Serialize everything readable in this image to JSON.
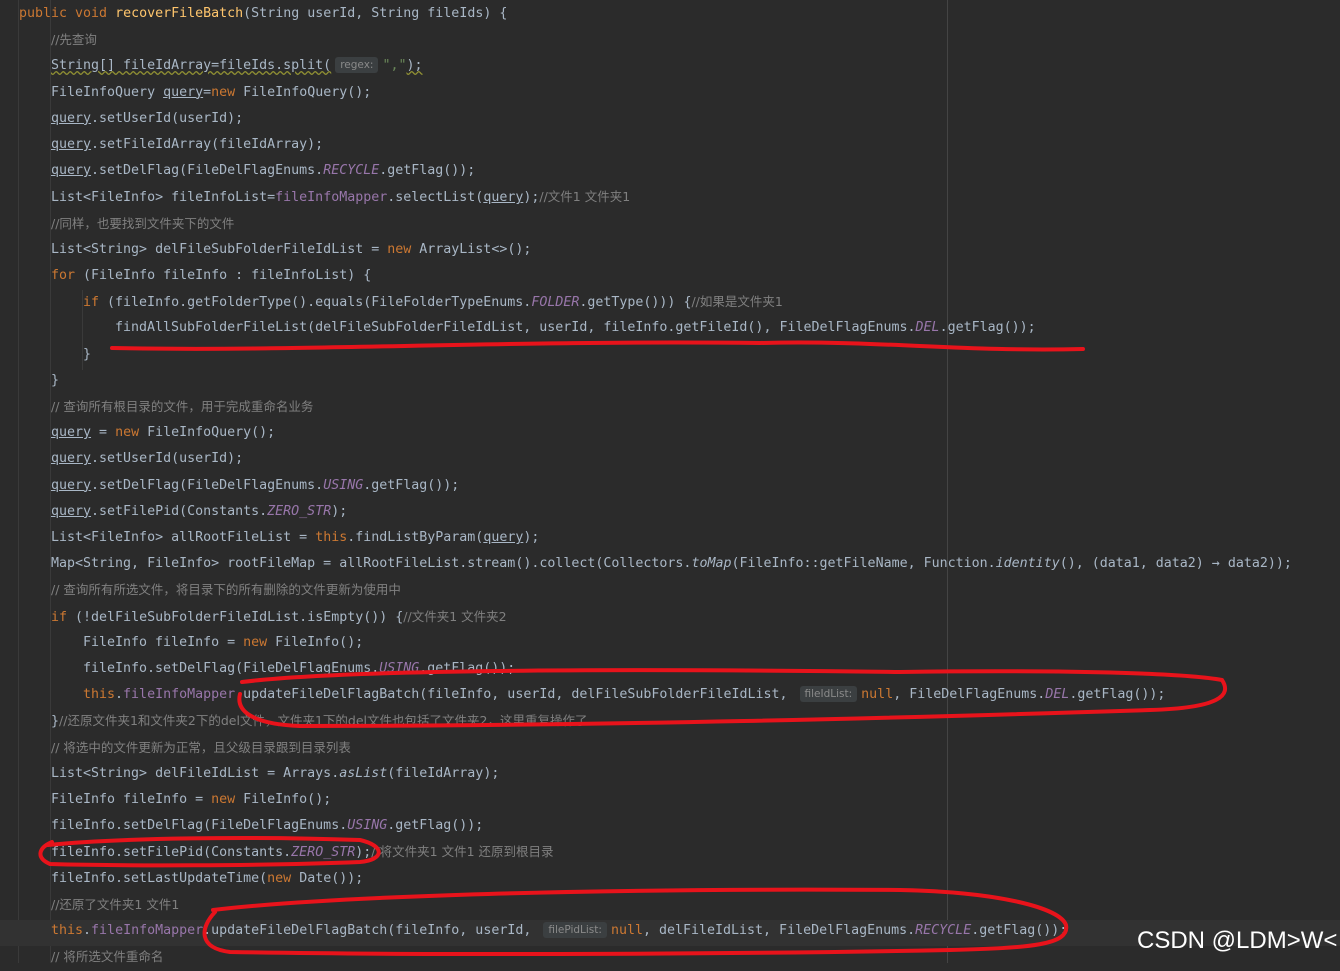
{
  "watermark": "CSDN @LDM>W<",
  "colors": {
    "background": "#2b2b2b",
    "keyword": "#cc7832",
    "method": "#ffc66d",
    "comment": "#808080",
    "field": "#9876aa",
    "string": "#6a8759",
    "annotation": "#e8131b"
  },
  "code": [
    {
      "tokens": [
        {
          "c": "kw",
          "t": "public void "
        },
        {
          "c": "fn",
          "t": "recoverFileBatch"
        },
        {
          "c": "pl",
          "t": "(String userId, String fileIds) {"
        }
      ]
    },
    {
      "tokens": [
        {
          "c": "cmc",
          "t": "//先查询"
        }
      ]
    },
    {
      "tokens": [
        {
          "c": "warn",
          "t": "String[] fileIdArray=fileIds.split("
        },
        {
          "c": "hint",
          "t": "regex:"
        },
        {
          "c": "str",
          "t": "\",\""
        },
        {
          "c": "warn",
          "t": ");"
        }
      ]
    },
    {
      "tokens": [
        {
          "c": "pl",
          "t": "FileInfoQuery "
        },
        {
          "c": "ul",
          "t": "query"
        },
        {
          "c": "pl",
          "t": "="
        },
        {
          "c": "kw",
          "t": "new "
        },
        {
          "c": "pl",
          "t": "FileInfoQuery();"
        }
      ]
    },
    {
      "tokens": [
        {
          "c": "ul",
          "t": "query"
        },
        {
          "c": "pl",
          "t": ".setUserId(userId);"
        }
      ]
    },
    {
      "tokens": [
        {
          "c": "ul",
          "t": "query"
        },
        {
          "c": "pl",
          "t": ".setFileIdArray(fileIdArray);"
        }
      ]
    },
    {
      "tokens": [
        {
          "c": "ul",
          "t": "query"
        },
        {
          "c": "pl",
          "t": ".setDelFlag(FileDelFlagEnums."
        },
        {
          "c": "efld",
          "t": "RECYCLE"
        },
        {
          "c": "pl",
          "t": ".getFlag());"
        }
      ]
    },
    {
      "tokens": [
        {
          "c": "pl",
          "t": "List<FileInfo> fileInfoList="
        },
        {
          "c": "fld",
          "t": "fileInfoMapper"
        },
        {
          "c": "pl",
          "t": ".selectList("
        },
        {
          "c": "ul",
          "t": "query"
        },
        {
          "c": "pl",
          "t": ");"
        },
        {
          "c": "cmc",
          "t": "//文件1 文件夹1"
        }
      ]
    },
    {
      "tokens": [
        {
          "c": "cmc",
          "t": "//同样，也要找到文件夹下的文件"
        }
      ]
    },
    {
      "tokens": [
        {
          "c": "pl",
          "t": "List<String> delFileSubFolderFileIdList = "
        },
        {
          "c": "kw",
          "t": "new "
        },
        {
          "c": "pl",
          "t": "ArrayList<>();"
        }
      ]
    },
    {
      "tokens": [
        {
          "c": "kw",
          "t": "for "
        },
        {
          "c": "pl",
          "t": "(FileInfo fileInfo : fileInfoList) {"
        }
      ]
    },
    {
      "tokens": [
        {
          "c": "kw",
          "t": "if "
        },
        {
          "c": "pl",
          "t": "(fileInfo.getFolderType().equals(FileFolderTypeEnums."
        },
        {
          "c": "efld",
          "t": "FOLDER"
        },
        {
          "c": "pl",
          "t": ".getType())) {"
        },
        {
          "c": "cmc",
          "t": "//如果是文件夹1"
        }
      ]
    },
    {
      "tokens": [
        {
          "c": "pl",
          "t": "findAllSubFolderFileList(delFileSubFolderFileIdList, userId, fileInfo.getFileId(), FileDelFlagEnums."
        },
        {
          "c": "efld",
          "t": "DEL"
        },
        {
          "c": "pl",
          "t": ".getFlag());"
        }
      ]
    },
    {
      "tokens": [
        {
          "c": "pl",
          "t": "}"
        }
      ]
    },
    {
      "tokens": [
        {
          "c": "pl",
          "t": "}"
        }
      ]
    },
    {
      "tokens": [
        {
          "c": "cmc",
          "t": "// 查询所有根目录的文件，用于完成重命名业务"
        }
      ]
    },
    {
      "tokens": [
        {
          "c": "ul",
          "t": "query"
        },
        {
          "c": "pl",
          "t": " = "
        },
        {
          "c": "kw",
          "t": "new "
        },
        {
          "c": "pl",
          "t": "FileInfoQuery();"
        }
      ]
    },
    {
      "tokens": [
        {
          "c": "ul",
          "t": "query"
        },
        {
          "c": "pl",
          "t": ".setUserId(userId);"
        }
      ]
    },
    {
      "tokens": [
        {
          "c": "ul",
          "t": "query"
        },
        {
          "c": "pl",
          "t": ".setDelFlag(FileDelFlagEnums."
        },
        {
          "c": "efld",
          "t": "USING"
        },
        {
          "c": "pl",
          "t": ".getFlag());"
        }
      ]
    },
    {
      "tokens": [
        {
          "c": "ul",
          "t": "query"
        },
        {
          "c": "pl",
          "t": ".setFilePid(Constants."
        },
        {
          "c": "efld",
          "t": "ZERO_STR"
        },
        {
          "c": "pl",
          "t": ");"
        }
      ]
    },
    {
      "tokens": [
        {
          "c": "pl",
          "t": "List<FileInfo> allRootFileList = "
        },
        {
          "c": "kw",
          "t": "this"
        },
        {
          "c": "pl",
          "t": ".findListByParam("
        },
        {
          "c": "ul",
          "t": "query"
        },
        {
          "c": "pl",
          "t": ");"
        }
      ]
    },
    {
      "tokens": [
        {
          "c": "pl",
          "t": "Map<String, FileInfo> rootFileMap = allRootFileList.stream().collect(Collectors."
        },
        {
          "c": "ital",
          "t": "toMap"
        },
        {
          "c": "pl",
          "t": "(FileInfo::getFileName, Function."
        },
        {
          "c": "ital",
          "t": "identity"
        },
        {
          "c": "pl",
          "t": "(), (data1, data2) → data2));"
        }
      ]
    },
    {
      "tokens": [
        {
          "c": "cmc",
          "t": "// 查询所有所选文件，将目录下的所有删除的文件更新为使用中"
        }
      ]
    },
    {
      "tokens": [
        {
          "c": "kw",
          "t": "if "
        },
        {
          "c": "pl",
          "t": "(!delFileSubFolderFileIdList.isEmpty()) {"
        },
        {
          "c": "cmc",
          "t": "//文件夹1 文件夹2"
        }
      ]
    },
    {
      "tokens": [
        {
          "c": "pl",
          "t": "FileInfo fileInfo = "
        },
        {
          "c": "kw",
          "t": "new "
        },
        {
          "c": "pl",
          "t": "FileInfo();"
        }
      ]
    },
    {
      "tokens": [
        {
          "c": "pl",
          "t": "fileInfo.setDelFlag(FileDelFlagEnums."
        },
        {
          "c": "efld",
          "t": "USING"
        },
        {
          "c": "pl",
          "t": ".getFlag());"
        }
      ]
    },
    {
      "tokens": [
        {
          "c": "kw",
          "t": "this"
        },
        {
          "c": "pl",
          "t": "."
        },
        {
          "c": "fld",
          "t": "fileInfoMapper"
        },
        {
          "c": "pl",
          "t": ".updateFileDelFlagBatch(fileInfo, userId, delFileSubFolderFileIdList, "
        },
        {
          "c": "hint",
          "t": "fileIdList:"
        },
        {
          "c": "kw",
          "t": "null"
        },
        {
          "c": "pl",
          "t": ", FileDelFlagEnums."
        },
        {
          "c": "efld",
          "t": "DEL"
        },
        {
          "c": "pl",
          "t": ".getFlag());"
        }
      ]
    },
    {
      "tokens": [
        {
          "c": "pl",
          "t": "}"
        },
        {
          "c": "cmc",
          "t": "//还原文件夹1和文件夹2下的del文件，文件夹1下的del文件也包括了文件夹2，这里重复操作了"
        }
      ]
    },
    {
      "tokens": [
        {
          "c": "cmc",
          "t": "// 将选中的文件更新为正常，且父级目录跟到目录列表"
        }
      ]
    },
    {
      "tokens": [
        {
          "c": "pl",
          "t": "List<String> delFileIdList = Arrays."
        },
        {
          "c": "ital",
          "t": "asList"
        },
        {
          "c": "pl",
          "t": "(fileIdArray);"
        }
      ]
    },
    {
      "tokens": [
        {
          "c": "pl",
          "t": "FileInfo fileInfo = "
        },
        {
          "c": "kw",
          "t": "new "
        },
        {
          "c": "pl",
          "t": "FileInfo();"
        }
      ]
    },
    {
      "tokens": [
        {
          "c": "pl",
          "t": "fileInfo.setDelFlag(FileDelFlagEnums."
        },
        {
          "c": "efld",
          "t": "USING"
        },
        {
          "c": "pl",
          "t": ".getFlag());"
        }
      ]
    },
    {
      "tokens": [
        {
          "c": "pl",
          "t": "fileInfo.setFilePid(Constants."
        },
        {
          "c": "efld",
          "t": "ZERO_STR"
        },
        {
          "c": "pl",
          "t": ");"
        },
        {
          "c": "cmc",
          "t": "//将文件夹1 文件1 还原到根目录"
        }
      ]
    },
    {
      "tokens": [
        {
          "c": "pl",
          "t": "fileInfo.setLastUpdateTime("
        },
        {
          "c": "kw",
          "t": "new "
        },
        {
          "c": "pl",
          "t": "Date());"
        }
      ]
    },
    {
      "tokens": [
        {
          "c": "cmc",
          "t": "//还原了文件夹1 文件1"
        }
      ]
    },
    {
      "tokens": [
        {
          "c": "kw",
          "t": "this"
        },
        {
          "c": "pl",
          "t": "."
        },
        {
          "c": "fld",
          "t": "fileInfoMapper"
        },
        {
          "c": "pl",
          "t": ".updateFileDelFlagBatch(fileInfo, userId, "
        },
        {
          "c": "hint",
          "t": "filePidList:"
        },
        {
          "c": "kw",
          "t": "null"
        },
        {
          "c": "pl",
          "t": ", delFileIdList, FileDelFlagEnums."
        },
        {
          "c": "efld",
          "t": "RECYCLE"
        },
        {
          "c": "pl",
          "t": ".getFlag());"
        }
      ]
    },
    {
      "tokens": [
        {
          "c": "cmc",
          "t": "// 将所选文件重命名"
        }
      ]
    }
  ]
}
